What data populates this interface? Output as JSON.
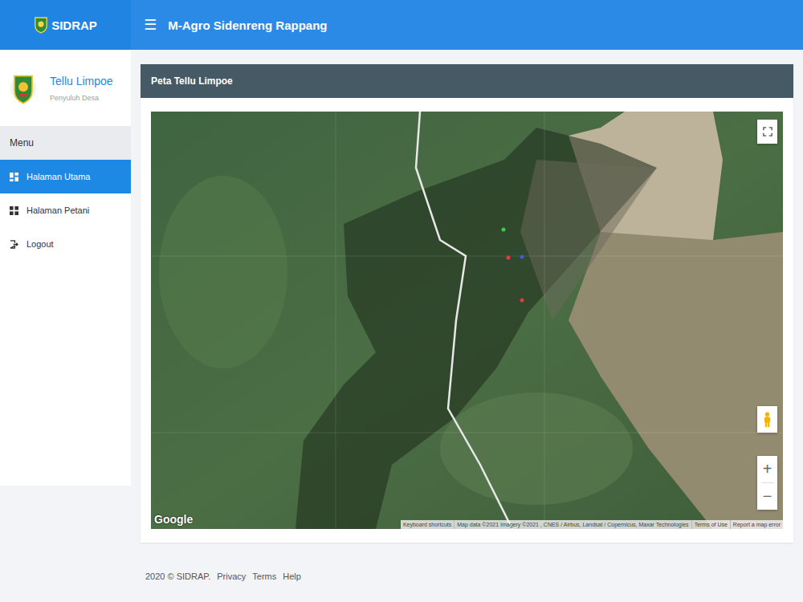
{
  "header": {
    "brand": "SIDRAP",
    "menu_toggle": "☰",
    "title": "M-Agro Sidenreng Rappang"
  },
  "profile": {
    "name": "Tellu Limpoe",
    "role": "Penyuluh Desa"
  },
  "sidebar": {
    "heading": "Menu",
    "items": [
      {
        "label": "Halaman Utama",
        "selected": true
      },
      {
        "label": "Halaman Petani",
        "selected": false
      },
      {
        "label": "Logout",
        "selected": false
      }
    ]
  },
  "map": {
    "title": "Peta Tellu Limpoe",
    "logo": "Google",
    "zoom_in": "+",
    "zoom_out": "−",
    "attribution": [
      "Keyboard shortcuts",
      "Map data ©2021 Imagery ©2021 , CNES / Airbus, Landsat / Copernicus, Maxar Technologies",
      "Terms of Use",
      "Report a map error"
    ]
  },
  "footer": {
    "copyright": "2020 © SIDRAP.",
    "links": [
      "Privacy",
      "Terms",
      "Help"
    ]
  }
}
